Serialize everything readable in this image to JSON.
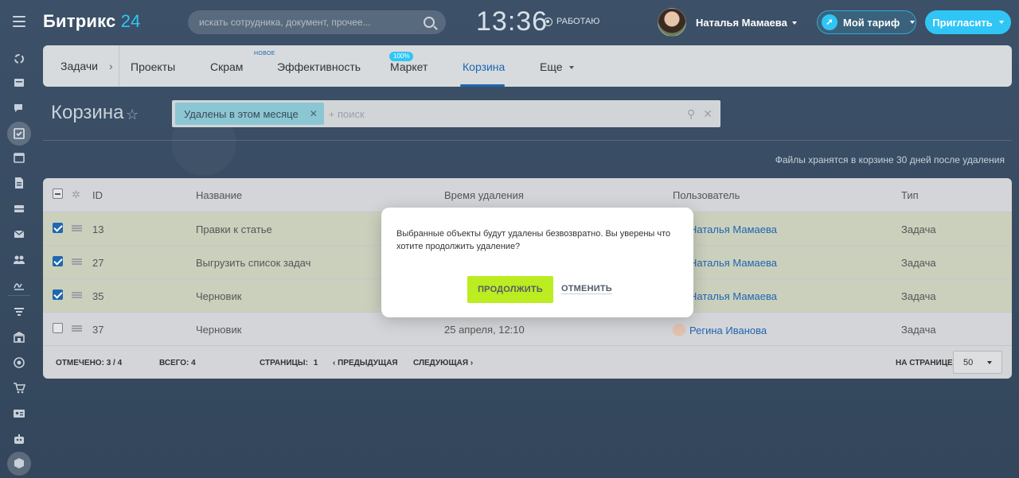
{
  "header": {
    "logo_name": "Битрикс",
    "logo_num": "24",
    "search_placeholder": "искать сотрудника, документ, прочее...",
    "time": "13:36",
    "status": "РАБОТАЮ",
    "user_name": "Наталья Мамаева",
    "tariff": "Мой тариф",
    "invite": "Пригласить"
  },
  "nav": {
    "tasks": "Задачи",
    "tabs": [
      "Проекты",
      "Скрам",
      "Эффективность",
      "Маркет",
      "Корзина",
      "Еще"
    ],
    "badge_new": "НОВОЕ",
    "badge_percent": "100%",
    "active": "Корзина"
  },
  "page": {
    "title": "Корзина",
    "filter_chip": "Удалены в этом месяце",
    "filter_placeholder": "+ поиск",
    "info": "Файлы хранятся в корзине 30 дней после удаления"
  },
  "grid": {
    "columns": [
      "ID",
      "Название",
      "Время удаления",
      "Пользователь",
      "Тип"
    ],
    "rows": [
      {
        "id": "13",
        "name": "Правки к статье",
        "time": "",
        "user": "Наталья Мамаева",
        "type": "Задача",
        "checked": true
      },
      {
        "id": "27",
        "name": "Выгрузить список задач",
        "time": "",
        "user": "Наталья Мамаева",
        "type": "Задача",
        "checked": true
      },
      {
        "id": "35",
        "name": "Черновик",
        "time": "",
        "user": "Наталья Мамаева",
        "type": "Задача",
        "checked": true
      },
      {
        "id": "37",
        "name": "Черновик",
        "time": "25 апреля, 12:10",
        "user": "Регина Иванова",
        "type": "Задача",
        "checked": false
      }
    ],
    "footer": {
      "marked_label": "ОТМЕЧЕНО:",
      "marked_value": "3 / 4",
      "total_label": "ВСЕГО:",
      "total_value": "4",
      "pages_label": "СТРАНИЦЫ:",
      "pages_value": "1",
      "prev": "ПРЕДЫДУЩАЯ",
      "next": "СЛЕДУЮЩАЯ",
      "per_page_label": "НА СТРАНИЦЕ:",
      "per_page_value": "50"
    }
  },
  "dialog": {
    "message": "Выбранные объекты будут удалены безвозвратно. Вы уверены что хотите продолжить удаление?",
    "continue": "ПРОДОЛЖИТЬ",
    "cancel": "ОТМЕНИТЬ"
  },
  "colors": {
    "accent": "#2fc6f6",
    "link": "#2066b0",
    "continue_button": "#bbed21"
  }
}
